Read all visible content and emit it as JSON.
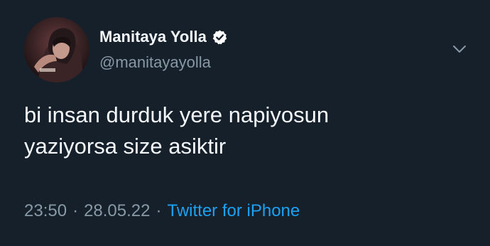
{
  "tweet": {
    "author": {
      "name": "Manitaya Yolla",
      "handle": "@manitayayolla",
      "verified": true,
      "avatar_icon": "avatar-illustration-icon"
    },
    "text_lines": [
      "bi insan durduk yere napiyosun",
      "yaziyorsa size asiktir"
    ],
    "time": "23:50",
    "separator": "·",
    "date": "28.05.22",
    "source": "Twitter for iPhone",
    "menu_icon": "chevron-down-icon"
  },
  "colors": {
    "background": "#15202b",
    "primary_text": "#f5f8fa",
    "secondary_text": "#8899a6",
    "link": "#1da1f2"
  }
}
